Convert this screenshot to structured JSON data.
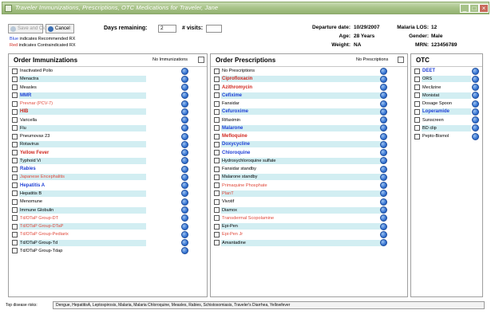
{
  "window": {
    "title": "Traveler Immunizations, Prescriptions, OTC Medications for Traveler, Jane",
    "minimize_label": "_",
    "maximize_label": "□",
    "close_label": "×"
  },
  "toolbar": {
    "save_label": "Save and Close",
    "cancel_label": "Cancel",
    "days_remaining_label": "Days remaining:",
    "days_remaining_value": "2",
    "visits_label": "# visits:",
    "visits_value": ""
  },
  "legend": {
    "blue_word": "Blue",
    "blue_text": " indicates Recommended RX",
    "red_word": "Red",
    "red_text": " indicates Contraindicated RX"
  },
  "traveler": {
    "departure_label": "Departure date:",
    "departure_value": "10/29/2007",
    "age_label": "Age:",
    "age_value": "28 Years",
    "weight_label": "Weight:",
    "weight_value": "NA",
    "malaria_label": "Malaria LOS:",
    "malaria_value": "12",
    "gender_label": "Gender:",
    "gender_value": "Male",
    "mrn_label": "MRN:",
    "mrn_value": "123456789"
  },
  "immunizations": {
    "header": "Order Immunizations",
    "none_label": "No Immunizations",
    "items": [
      {
        "label": "Inactivated Polio",
        "status": "normal"
      },
      {
        "label": "Menactra",
        "status": "normal"
      },
      {
        "label": "Measles",
        "status": "normal"
      },
      {
        "label": "MMR",
        "status": "recommended"
      },
      {
        "label": "Prevnar (PCV-7)",
        "status": "contraindicated_light"
      },
      {
        "label": "HIB",
        "status": "contraindicated"
      },
      {
        "label": "Varicella",
        "status": "normal"
      },
      {
        "label": "Flu",
        "status": "normal"
      },
      {
        "label": "Pneumovax 23",
        "status": "normal"
      },
      {
        "label": "Rotavirus",
        "status": "normal"
      },
      {
        "label": "Yellow Fever",
        "status": "contraindicated"
      },
      {
        "label": "Typhoid Vi",
        "status": "normal"
      },
      {
        "label": "Rabies",
        "status": "recommended"
      },
      {
        "label": "Japanese Encephalitis",
        "status": "contraindicated_light"
      },
      {
        "label": "Hepatitis A",
        "status": "recommended"
      },
      {
        "label": "Hepatitis B",
        "status": "normal"
      },
      {
        "label": "Menomune",
        "status": "normal"
      },
      {
        "label": "Immune Globulin",
        "status": "normal"
      },
      {
        "label": "Td/DTaP Group-DT",
        "status": "contraindicated_light"
      },
      {
        "label": "Td/DTaP Group-DTaP",
        "status": "contraindicated_light"
      },
      {
        "label": "Td/DTaP Group-Pediarix",
        "status": "contraindicated_light"
      },
      {
        "label": "Td/DTaP Group-Td",
        "status": "normal"
      },
      {
        "label": "Td/DTaP Group-Tdap",
        "status": "normal"
      }
    ]
  },
  "prescriptions": {
    "header": "Order Prescriptions",
    "none_label": "No Prescriptions",
    "items": [
      {
        "label": "No Prescriptions",
        "status": "normal"
      },
      {
        "label": "Ciprofloxacin",
        "status": "contraindicated"
      },
      {
        "label": "Azithromycin",
        "status": "contraindicated"
      },
      {
        "label": "Cefixime",
        "status": "recommended"
      },
      {
        "label": "Fansidar",
        "status": "normal"
      },
      {
        "label": "Cefuroxime",
        "status": "recommended"
      },
      {
        "label": "Rifaximin",
        "status": "normal"
      },
      {
        "label": "Malarone",
        "status": "recommended"
      },
      {
        "label": "Mefloquine",
        "status": "contraindicated"
      },
      {
        "label": "Doxycycline",
        "status": "recommended"
      },
      {
        "label": "Chloroquine",
        "status": "recommended"
      },
      {
        "label": "Hydroxychloroquine sulfate",
        "status": "normal"
      },
      {
        "label": "Fansidar standby",
        "status": "normal"
      },
      {
        "label": "Malarone standby",
        "status": "normal"
      },
      {
        "label": "Primaquine Phosphate",
        "status": "contraindicated_light"
      },
      {
        "label": "PlanT",
        "status": "contraindicated_light"
      },
      {
        "label": "Vivotif",
        "status": "normal"
      },
      {
        "label": "Diamox",
        "status": "normal"
      },
      {
        "label": "Transdermal Scopolamine",
        "status": "contraindicated_light"
      },
      {
        "label": "Epi-Pen",
        "status": "normal"
      },
      {
        "label": "Epi-Pen Jr",
        "status": "contraindicated_light"
      },
      {
        "label": "Amantadine",
        "status": "normal"
      }
    ]
  },
  "otc": {
    "header": "OTC",
    "items": [
      {
        "label": "DEET",
        "status": "recommended"
      },
      {
        "label": "ORS",
        "status": "normal"
      },
      {
        "label": "Meclizine",
        "status": "normal"
      },
      {
        "label": "Monistat",
        "status": "normal"
      },
      {
        "label": "Dosage Spoon",
        "status": "normal"
      },
      {
        "label": "Loperamide",
        "status": "recommended"
      },
      {
        "label": "Sunscreen",
        "status": "normal"
      },
      {
        "label": "BD clip",
        "status": "normal"
      },
      {
        "label": "Pepto-Bismol",
        "status": "normal"
      }
    ]
  },
  "footer": {
    "label": "Top disease risks:",
    "value": "Dengue, HepatitisA, Leptospirosis, Malaria, Malaria Chloroquine, Measles, Rabies, Schistosomiasis, Traveler's Diarrhea, Yellowfever"
  },
  "colors": {
    "recommended": "#1e3fd6",
    "contraindicated": "#d0281f",
    "contraindicated_light": "#e0483a",
    "row_tint": "#d2eef2",
    "titlebar": "#a9c48a"
  }
}
